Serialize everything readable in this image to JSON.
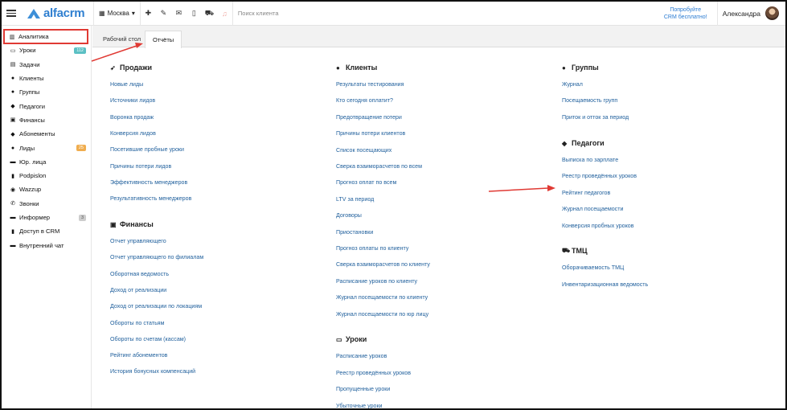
{
  "topbar": {
    "logo_text": "alfacrm",
    "branch": "Москва",
    "branch_caret": "▾",
    "icons": [
      "plus-icon",
      "wrench-icon",
      "mail-icon",
      "phone-icon",
      "cart-icon",
      "bell-icon"
    ],
    "search_placeholder": "Поиск клиента",
    "try_line1": "Попробуйте",
    "try_line2": "CRM бесплатно!",
    "user_name": "Александра"
  },
  "sidebar": {
    "items": [
      {
        "label": "Аналитика",
        "icon": "chart-icon",
        "glyph": "▥"
      },
      {
        "label": "Уроки",
        "icon": "calendar-icon",
        "glyph": "▭",
        "badge": "112"
      },
      {
        "label": "Задачи",
        "icon": "tasks-icon",
        "glyph": "▤"
      },
      {
        "label": "Клиенты",
        "icon": "user-icon",
        "glyph": "●"
      },
      {
        "label": "Группы",
        "icon": "users-icon",
        "glyph": "●"
      },
      {
        "label": "Педагоги",
        "icon": "graduation-cap-icon",
        "glyph": "◆"
      },
      {
        "label": "Финансы",
        "icon": "money-icon",
        "glyph": "▣"
      },
      {
        "label": "Абонементы",
        "icon": "tag-icon",
        "glyph": "◆"
      },
      {
        "label": "Лиды",
        "icon": "user-plus-icon",
        "glyph": "●",
        "badge": "25"
      },
      {
        "label": "Юр. лица",
        "icon": "bank-icon",
        "glyph": "▬"
      },
      {
        "label": "Podpislon",
        "icon": "document-icon",
        "glyph": "▮"
      },
      {
        "label": "Wazzup",
        "icon": "whatsapp-icon",
        "glyph": "◉"
      },
      {
        "label": "Звонки",
        "icon": "phone-icon",
        "glyph": "✆"
      },
      {
        "label": "Информер",
        "icon": "inbox-icon",
        "glyph": "▬",
        "badge": "3"
      },
      {
        "label": "Доступ в CRM",
        "icon": "lock-icon",
        "glyph": "▮"
      },
      {
        "label": "Внутренний чат",
        "icon": "chat-icon",
        "glyph": "▬"
      }
    ]
  },
  "tabs": [
    {
      "label": "Рабочий стол"
    },
    {
      "label": "Отчёты"
    }
  ],
  "columns": {
    "sales": {
      "title": "Продажи",
      "links": [
        "Новые лиды",
        "Источники лидов",
        "Воронка продаж",
        "Конверсия лидов",
        "Посетившие пробные уроки",
        "Причины потери лидов",
        "Эффективность менеджеров",
        "Результативность менеджеров"
      ]
    },
    "finance": {
      "title": "Финансы",
      "links": [
        "Отчет управляющего",
        "Отчет управляющего по филиалам",
        "Оборотная ведомость",
        "Доход от реализации",
        "Доход от реализации по локациям",
        "Обороты по статьям",
        "Обороты по счетам (кассам)",
        "Рейтинг абонементов",
        "История бонусных компенсаций"
      ]
    },
    "clients": {
      "title": "Клиенты",
      "links": [
        "Результаты тестирования",
        "Кто сегодня оплатит?",
        "Предотвращение потери",
        "Причины потери клиентов",
        "Список посещающих",
        "Сверка взаиморасчетов по всем",
        "Прогноз оплат по всем",
        "LTV за период",
        "Договоры",
        "Приостановки",
        "Прогноз оплаты по клиенту",
        "Сверка взаиморасчетов по клиенту",
        "Расписание уроков по клиенту",
        "Журнал посещаемости по клиенту",
        "Журнал посещаемости по юр лицу"
      ]
    },
    "lessons": {
      "title": "Уроки",
      "links": [
        "Расписание уроков",
        "Реестр проведённых уроков",
        "Пропущенные уроки",
        "Убыточные уроки"
      ]
    },
    "groups": {
      "title": "Группы",
      "links": [
        "Журнал",
        "Посещаемость групп",
        "Приток и отток за период"
      ]
    },
    "teachers": {
      "title": "Педагоги",
      "links": [
        "Выписка по зарплате",
        "Реестр проведённых уроков",
        "Рейтинг педагогов",
        "Журнал посещаемости",
        "Конверсия пробных уроков"
      ]
    },
    "inventory": {
      "title": "ТМЦ",
      "links": [
        "Оборачиваемость ТМЦ",
        "Инвентаризационная ведомость"
      ]
    }
  },
  "colors": {
    "link": "#1f5f9c",
    "accent": "#2f7fd0",
    "annotation": "#e03a34"
  }
}
